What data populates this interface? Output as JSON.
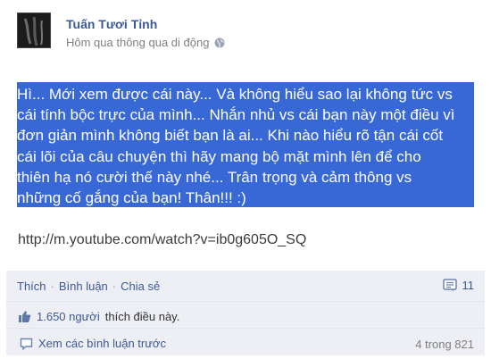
{
  "post": {
    "author": "Tuấn Tươi Tỉnh",
    "meta": "Hôm qua thông qua di động",
    "message_lines": [
      "Hì... Mới xem được cái này... Và không hiểu sao lại không tức vs",
      "cái tính bộc trực của mình... Nhắn nhủ vs cái bạn này một điều vì",
      "đơn giản mình không biết bạn là ai... Khi nào hiểu rõ tận cái cốt",
      "cái lõi của câu chuyện thì hãy mang bộ mặt mình lên để cho",
      "thiên hạ nó cười thế này nhé... Trân trọng và cảm thông vs",
      "những cố gắng của bạn! Thân!!! :)"
    ],
    "link": "http://m.youtube.com/watch?v=ib0g605O_SQ"
  },
  "ufi": {
    "like_label": "Thích",
    "comment_label": "Bình luận",
    "share_label": "Chia sẻ",
    "comment_count": "11",
    "likes_count": "1.650 người",
    "likes_text": "thích điều này.",
    "view_previous": "Xem các bình luận trước",
    "comment_range": "4 trong 821"
  },
  "colors": {
    "brand": "#3b5998",
    "selection": "#3867d6",
    "ufi_bg": "#edeff4"
  }
}
